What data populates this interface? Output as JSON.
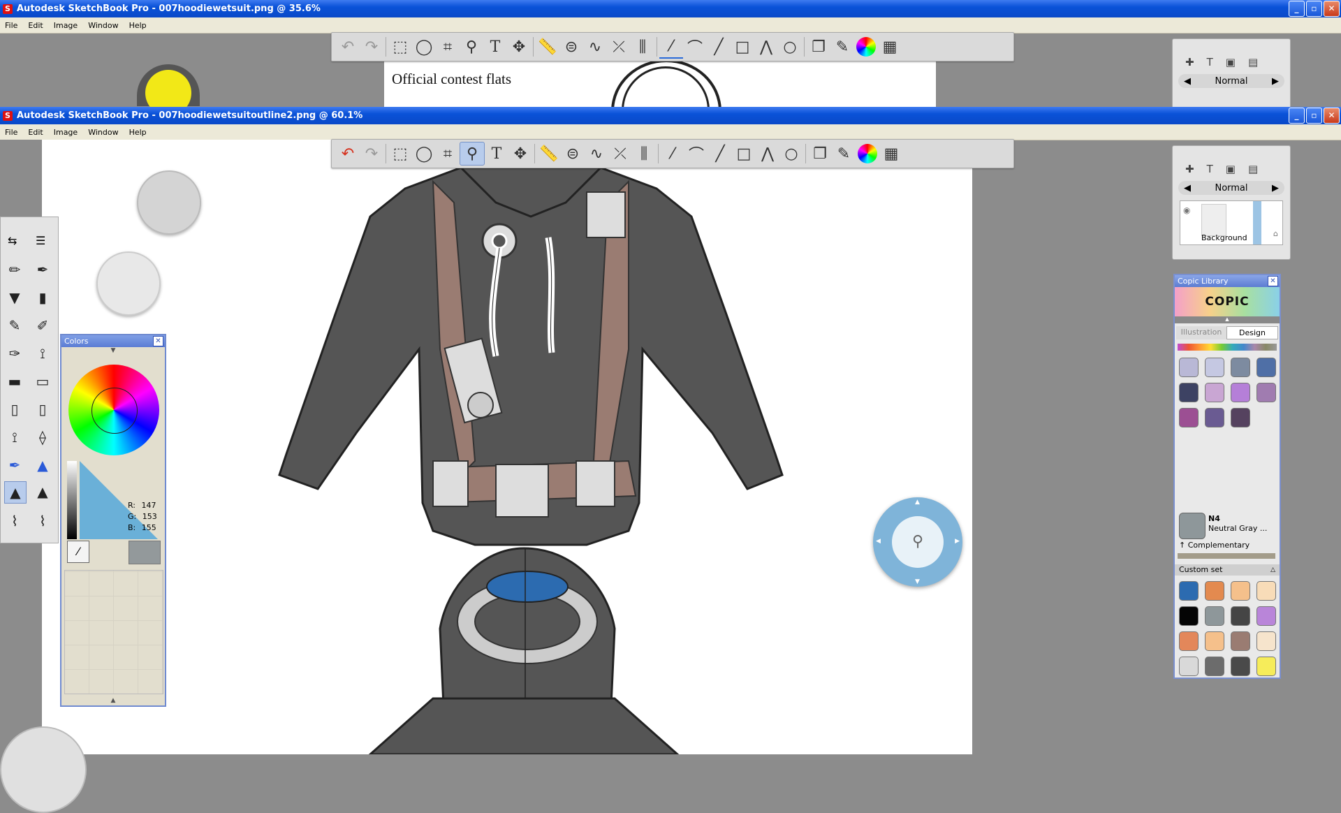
{
  "window_back": {
    "title": "Autodesk SketchBook Pro - 007hoodiewetsuit.png @ 35.6%",
    "menu": [
      "File",
      "Edit",
      "Image",
      "Window",
      "Help"
    ],
    "canvas_text": "Official contest flats",
    "layer_mode": "Normal"
  },
  "window_front": {
    "title": "Autodesk SketchBook Pro - 007hoodiewetsuitoutline2.png @ 60.1%",
    "menu": [
      "File",
      "Edit",
      "Image",
      "Window",
      "Help"
    ],
    "layer_mode": "Normal",
    "layer_name": "Background"
  },
  "window_buttons": {
    "minimize": "_",
    "maximize": "▫",
    "close": "✕"
  },
  "colors_panel": {
    "title": "Colors",
    "rgb_labels": {
      "r": "R:",
      "g": "G:",
      "b": "B:"
    },
    "r": "147",
    "g": "153",
    "b": "155",
    "current_color": "#93999b"
  },
  "copic_panel": {
    "title": "Copic Library",
    "logo": "COPIC",
    "tabs": [
      "Illustration",
      "Design"
    ],
    "active_tab": "Design",
    "library_swatches": [
      "#b9b8d6",
      "#c5c8e2",
      "#7d8ba0",
      "#4f6fa6",
      "#3d4263",
      "#c9a6d3",
      "#b57fd8",
      "#a07cb0",
      "#9c4f93",
      "#6a5b92",
      "#55425f"
    ],
    "selected_code": "N4",
    "selected_name": "Neutral Gray ...",
    "complementary_label": "Complementary",
    "custom_set_label": "Custom set",
    "custom_swatches": [
      "#2c6bb0",
      "#e38a4f",
      "#f5c08b",
      "#f8dcb8",
      "#050505",
      "#8e979a",
      "#454545",
      "#b985d9",
      "#e3875a",
      "#f5c08b",
      "#9a7c72",
      "#f6e4cc",
      "#d9d9d9",
      "#6c6c6c",
      "#4a4a4a",
      "#f6ec5a"
    ]
  },
  "tools": [
    "undo",
    "redo",
    "select-rect",
    "lasso",
    "crop",
    "zoom",
    "text",
    "move",
    "ruler",
    "ellipse-guide",
    "french-curve",
    "symmetry-x",
    "symmetry-y",
    "freehand-stroke",
    "curve",
    "line",
    "rectangle",
    "polyline",
    "circle",
    "layers",
    "brushes",
    "color-wheel",
    "palette"
  ],
  "pucks": {
    "back_color": "#f2e817",
    "front_color": "#c8c8c8"
  }
}
